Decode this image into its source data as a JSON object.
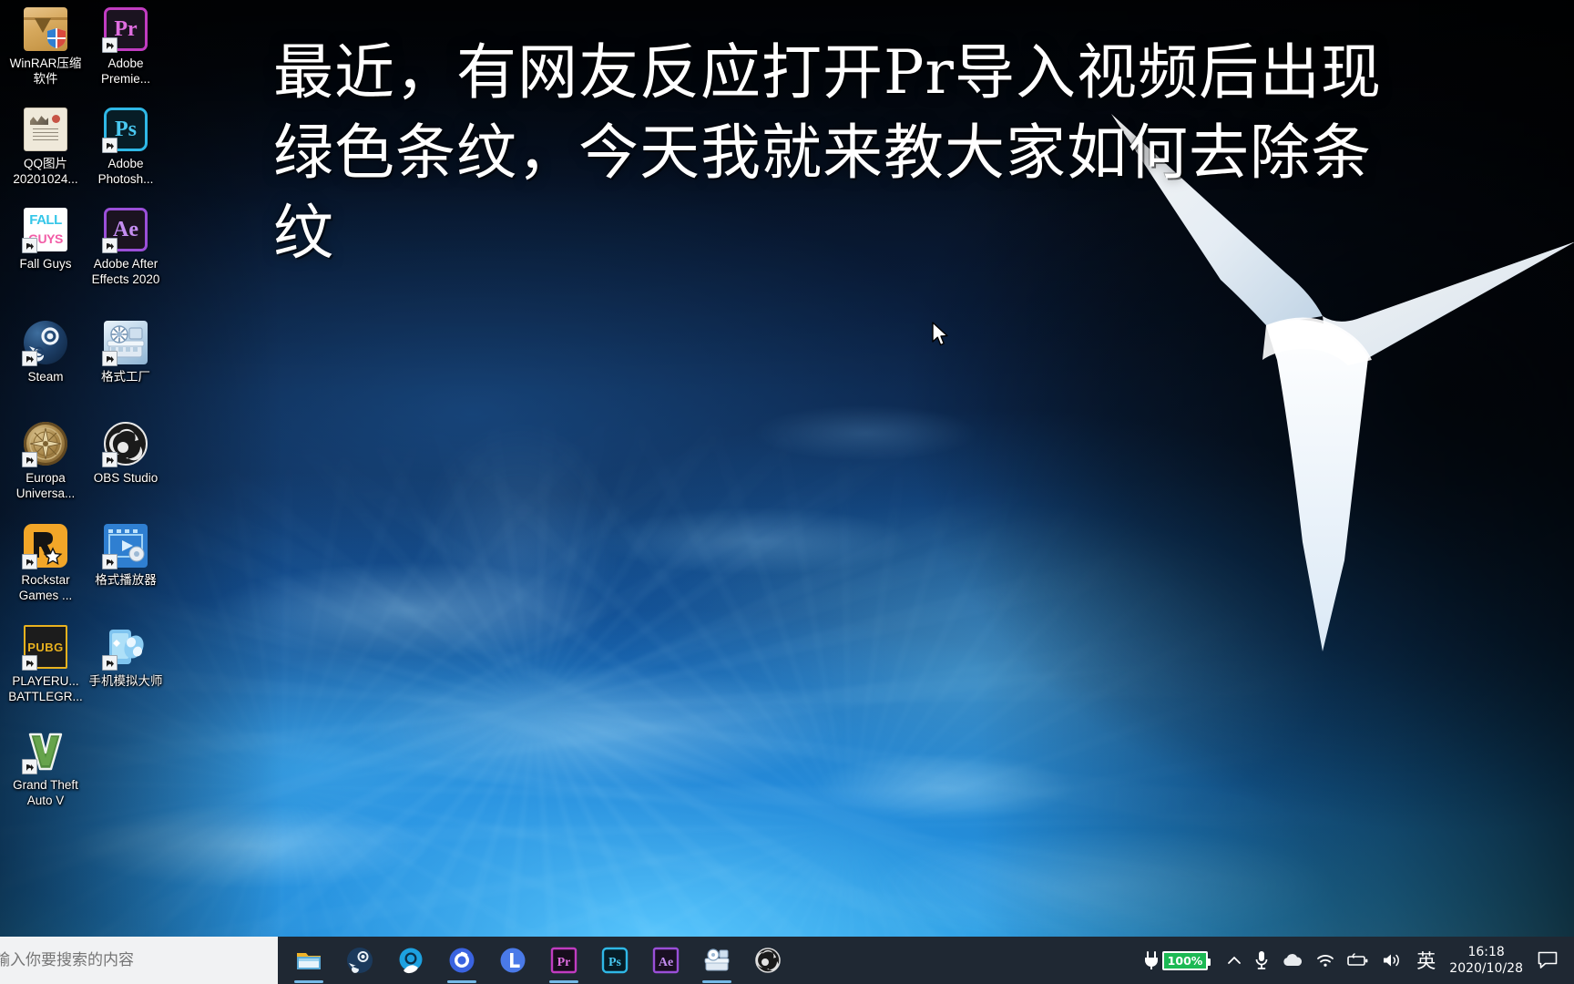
{
  "overlay": {
    "text": "最近，有网友反应打开Pr导入视频后出现绿色条纹，今天我就来教大家如何去除条纹"
  },
  "desktop": {
    "icons": [
      {
        "name": "winrar",
        "label": "WinRAR压缩软件",
        "icon": "winrar-icon",
        "shortcut": false
      },
      {
        "name": "premiere",
        "label": "Adobe Premie...",
        "icon": "adobe-premiere-icon",
        "shortcut": true,
        "glyph": "Pr"
      },
      {
        "name": "qq-image",
        "label": "QQ图片20201024...",
        "icon": "qq-image-icon",
        "shortcut": false
      },
      {
        "name": "photoshop",
        "label": "Adobe Photosh...",
        "icon": "adobe-photoshop-icon",
        "shortcut": true,
        "glyph": "Ps"
      },
      {
        "name": "fall-guys",
        "label": "Fall Guys",
        "icon": "fall-guys-icon",
        "shortcut": true,
        "glyph_top": "FALL",
        "glyph_bottom": "GUYS"
      },
      {
        "name": "after-effects",
        "label": "Adobe After Effects 2020",
        "icon": "adobe-after-effects-icon",
        "shortcut": true,
        "glyph": "Ae"
      },
      {
        "name": "steam",
        "label": "Steam",
        "icon": "steam-icon",
        "shortcut": true
      },
      {
        "name": "format-factory",
        "label": "格式工厂",
        "icon": "format-factory-icon",
        "shortcut": true
      },
      {
        "name": "europa",
        "label": "Europa Universa...",
        "icon": "europa-universalis-icon",
        "shortcut": true
      },
      {
        "name": "obs-studio",
        "label": "OBS Studio",
        "icon": "obs-studio-icon",
        "shortcut": true
      },
      {
        "name": "rockstar",
        "label": "Rockstar Games ...",
        "icon": "rockstar-games-icon",
        "shortcut": true
      },
      {
        "name": "format-player",
        "label": "格式播放器",
        "icon": "format-player-icon",
        "shortcut": true
      },
      {
        "name": "pubg",
        "label": "PLAYERU... BATTLEGR...",
        "icon": "pubg-icon",
        "shortcut": true,
        "glyph": "PUBG"
      },
      {
        "name": "phone-emulator",
        "label": "手机模拟大师",
        "icon": "phone-emulator-icon",
        "shortcut": true
      },
      {
        "name": "gta-v",
        "label": "Grand Theft Auto V",
        "icon": "gta-v-icon",
        "shortcut": true
      }
    ]
  },
  "taskbar": {
    "search": {
      "value": "",
      "placeholder": "输入你要搜索的内容"
    },
    "apps": [
      {
        "name": "file-explorer",
        "icon": "folder-icon",
        "running": true
      },
      {
        "name": "steam",
        "icon": "steam-icon",
        "running": false
      },
      {
        "name": "qq-browser",
        "icon": "qq-browser-icon",
        "running": false
      },
      {
        "name": "360-browser",
        "icon": "360-browser-icon",
        "running": true
      },
      {
        "name": "lenovo-app",
        "icon": "lenovo-icon",
        "running": false
      },
      {
        "name": "premiere",
        "icon": "adobe-premiere-icon",
        "running": true,
        "glyph": "Pr"
      },
      {
        "name": "photoshop",
        "icon": "adobe-photoshop-icon",
        "running": false,
        "glyph": "Ps"
      },
      {
        "name": "after-effects",
        "icon": "adobe-after-effects-icon",
        "running": false,
        "glyph": "Ae"
      },
      {
        "name": "format-factory",
        "icon": "format-factory-icon",
        "running": true
      },
      {
        "name": "obs-studio",
        "icon": "obs-studio-icon",
        "running": false
      }
    ],
    "tray": {
      "power_icon": "power-plug-icon",
      "battery_percent": "100%",
      "hidden_icons_chevron": "chevron-up-icon",
      "microphone_icon": "microphone-icon",
      "onedrive_icon": "onedrive-cloud-icon",
      "wifi_icon": "wifi-icon",
      "battery_icon": "battery-icon",
      "volume_icon": "speaker-icon",
      "ime_label": "英",
      "time": "16:18",
      "date": "2020/10/28",
      "action_center_icon": "action-center-icon"
    }
  },
  "colors": {
    "taskbar_bg": "#1f2833",
    "search_bg": "#f1f2f3",
    "battery_green": "#1db954",
    "running_underline": "#74b9e7",
    "accent_blue": "#2fa3dd"
  }
}
